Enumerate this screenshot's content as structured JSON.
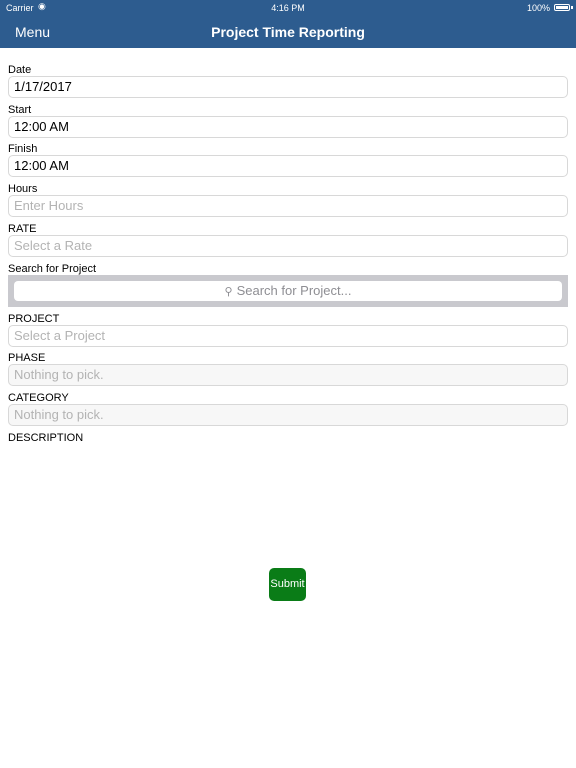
{
  "status_bar": {
    "carrier": "Carrier",
    "time": "4:16 PM",
    "battery": "100%"
  },
  "header": {
    "menu_label": "Menu",
    "title": "Project Time Reporting",
    "background_color": "#2d5c8f"
  },
  "form": {
    "date": {
      "label": "Date",
      "value": "1/17/2017"
    },
    "start": {
      "label": "Start",
      "value": "12:00 AM"
    },
    "finish": {
      "label": "Finish",
      "value": "12:00 AM"
    },
    "hours": {
      "label": "Hours",
      "placeholder": "Enter Hours"
    },
    "rate": {
      "label": "RATE",
      "placeholder": "Select a Rate"
    },
    "search_project": {
      "label": "Search for Project",
      "placeholder": "Search for Project..."
    },
    "project": {
      "label": "PROJECT",
      "placeholder": "Select a Project"
    },
    "phase": {
      "label": "PHASE",
      "placeholder": "Nothing to pick."
    },
    "category": {
      "label": "CATEGORY",
      "placeholder": "Nothing to pick."
    },
    "description": {
      "label": "DESCRIPTION"
    }
  },
  "submit": {
    "label": "Submit",
    "color": "#0a7c17"
  }
}
